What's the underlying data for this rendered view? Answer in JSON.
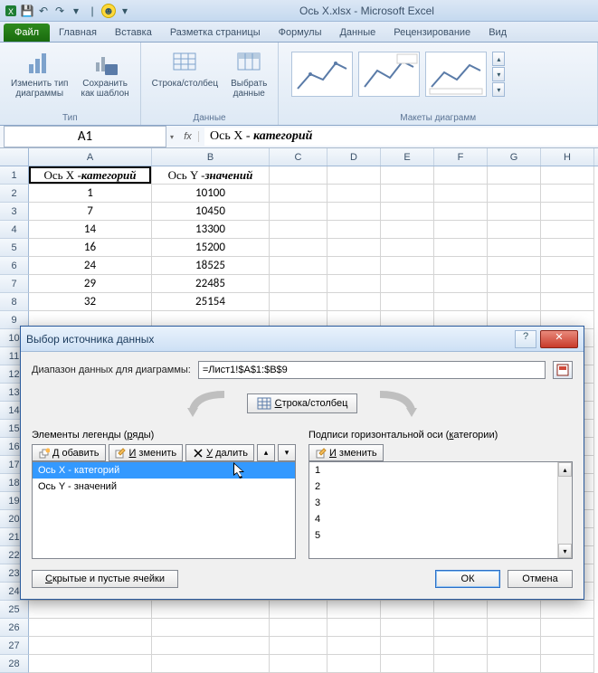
{
  "window": {
    "title": "Ось Х.xlsx  -  Microsoft Excel"
  },
  "ribbon": {
    "file": "Файл",
    "tabs": [
      "Главная",
      "Вставка",
      "Разметка страницы",
      "Формулы",
      "Данные",
      "Рецензирование",
      "Вид"
    ],
    "group_type": {
      "title": "Тип",
      "change_type": "Изменить тип\nдиаграммы",
      "save_template": "Сохранить\nкак шаблон"
    },
    "group_data": {
      "title": "Данные",
      "switch": "Строка/столбец",
      "select": "Выбрать\nданные"
    },
    "group_layouts": {
      "title": "Макеты диаграмм"
    }
  },
  "formula_bar": {
    "name": "A1",
    "fx": "fx",
    "value": "Ось Х - категорий"
  },
  "columns": [
    "A",
    "B",
    "C",
    "D",
    "E",
    "F",
    "G",
    "H"
  ],
  "rows": [
    1,
    2,
    3,
    4,
    5,
    6,
    7,
    8,
    9,
    10,
    11,
    12,
    13,
    14,
    15,
    16,
    17,
    18,
    19,
    20,
    21,
    22,
    23,
    24,
    25,
    26,
    27,
    28
  ],
  "sheet": {
    "header_a_prefix": "Ось Х - ",
    "header_a_em": "категорий",
    "header_b_prefix": "Ось Y - ",
    "header_b_em": "значений",
    "data": [
      {
        "x": "1",
        "y": "10100"
      },
      {
        "x": "7",
        "y": "10450"
      },
      {
        "x": "14",
        "y": "13300"
      },
      {
        "x": "16",
        "y": "15200"
      },
      {
        "x": "24",
        "y": "18525"
      },
      {
        "x": "29",
        "y": "22485"
      },
      {
        "x": "32",
        "y": "25154"
      }
    ]
  },
  "dialog": {
    "title": "Выбор источника данных",
    "range_label": "Диапазон данных для диаграммы:",
    "range_value": "=Лист1!$A$1:$B$9",
    "swap_btn": "Строка/столбец",
    "legend_title": "Элементы легенды (ряды)",
    "axis_title": "Подписи горизонтальной оси (категории)",
    "btn_add": "Добавить",
    "btn_edit": "Изменить",
    "btn_delete": "Удалить",
    "btn_edit2": "Изменить",
    "series": [
      "Ось Х - категорий",
      "Ось Y - значений"
    ],
    "categories": [
      "1",
      "2",
      "3",
      "4",
      "5"
    ],
    "hidden_cells_btn": "Скрытые и пустые ячейки",
    "ok": "ОК",
    "cancel": "Отмена"
  }
}
